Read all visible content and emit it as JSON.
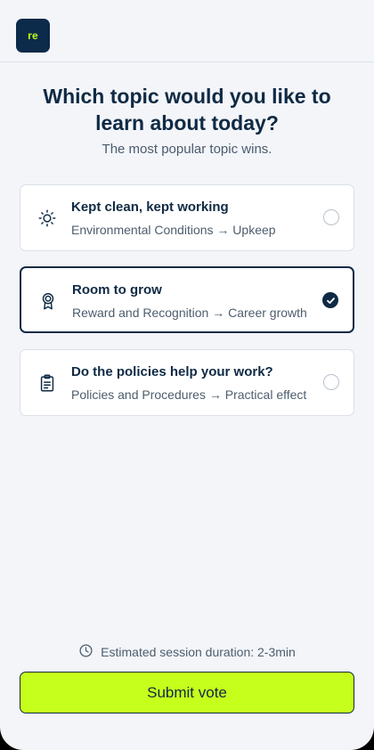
{
  "header": {
    "logo_text": "re"
  },
  "question": {
    "title": "Which topic would you like to learn about today?",
    "subtitle": "The most popular topic wins."
  },
  "options": [
    {
      "title": "Kept clean, kept working",
      "path": "Environmental Conditions → Upkeep",
      "icon": "sun-icon",
      "selected": false
    },
    {
      "title": "Room to grow",
      "path": "Reward and Recognition → Career growth",
      "icon": "award-ribbon-icon",
      "selected": true
    },
    {
      "title": "Do the policies help your work?",
      "path": "Policies and Procedures → Practical effect",
      "icon": "clipboard-icon",
      "selected": false
    }
  ],
  "footer": {
    "duration_text": "Estimated session duration: 2-3min",
    "submit_label": "Submit vote"
  },
  "colors": {
    "brand_dark": "#0f2a44",
    "accent_lime": "#c6ff1c",
    "background": "#f3f5f9"
  }
}
